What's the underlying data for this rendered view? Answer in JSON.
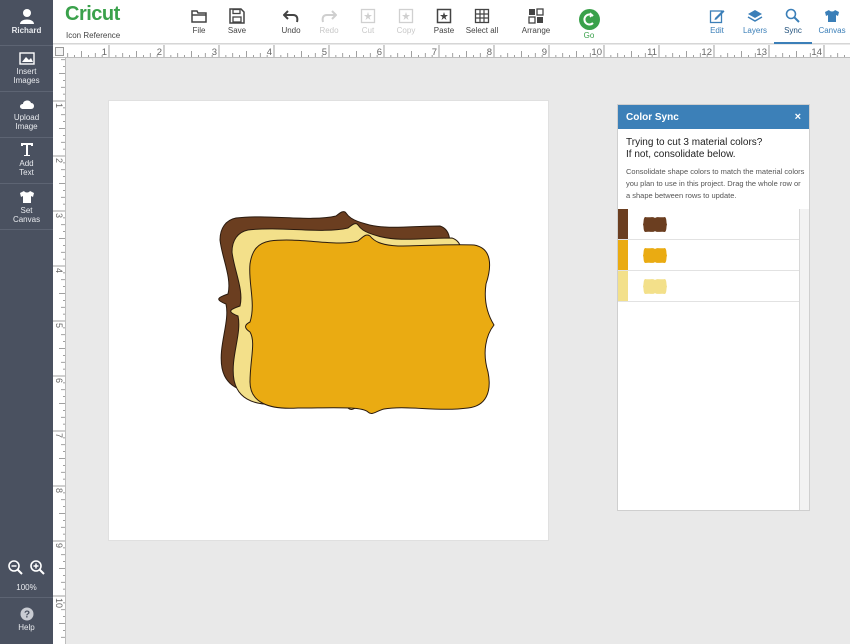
{
  "sidebar": {
    "user": "Richard",
    "items": [
      {
        "label_1": "Insert",
        "label_2": "Images",
        "icon": "insert-images-icon"
      },
      {
        "label_1": "Upload",
        "label_2": "Image",
        "icon": "upload-cloud-icon"
      },
      {
        "label_1": "Add",
        "label_2": "Text",
        "icon": "text-icon"
      },
      {
        "label_1": "Set",
        "label_2": "Canvas",
        "icon": "shirt-icon"
      }
    ],
    "zoom": "100%",
    "help": "Help"
  },
  "header": {
    "logo": "Cricut",
    "icon_reference": "Icon Reference",
    "tools": {
      "file": "File",
      "save": "Save",
      "undo": "Undo",
      "redo": "Redo",
      "cut": "Cut",
      "copy": "Copy",
      "paste": "Paste",
      "select_all": "Select all",
      "arrange": "Arrange",
      "go": "Go"
    },
    "right_tabs": {
      "edit": "Edit",
      "layers": "Layers",
      "sync": "Sync",
      "canvas": "Canvas"
    }
  },
  "ruler": {
    "top_numbers": [
      "1",
      "2",
      "3",
      "4",
      "5",
      "6",
      "7",
      "8",
      "9",
      "10",
      "11",
      "12",
      "13",
      "14"
    ],
    "left_numbers": [
      "1",
      "2",
      "3",
      "4",
      "5",
      "6",
      "7",
      "8",
      "9",
      "10"
    ]
  },
  "color_sync": {
    "title": "Color Sync",
    "close": "×",
    "question_1": "Trying to cut 3 material colors?",
    "question_2": "If not, consolidate below.",
    "description": "Consolidate shape colors to match the material colors you plan to use in this project. Drag the whole row or a shape between rows to update.",
    "rows": [
      {
        "color": "#6b3e20"
      },
      {
        "color": "#eaab12"
      },
      {
        "color": "#f3e08a"
      }
    ]
  },
  "colors": {
    "sidebar": "#4a5160",
    "accent": "#3c80b8",
    "brand": "#3aa14b",
    "shape_brown": "#6b3e20",
    "shape_cream": "#f3e08a",
    "shape_gold": "#eaab12"
  }
}
